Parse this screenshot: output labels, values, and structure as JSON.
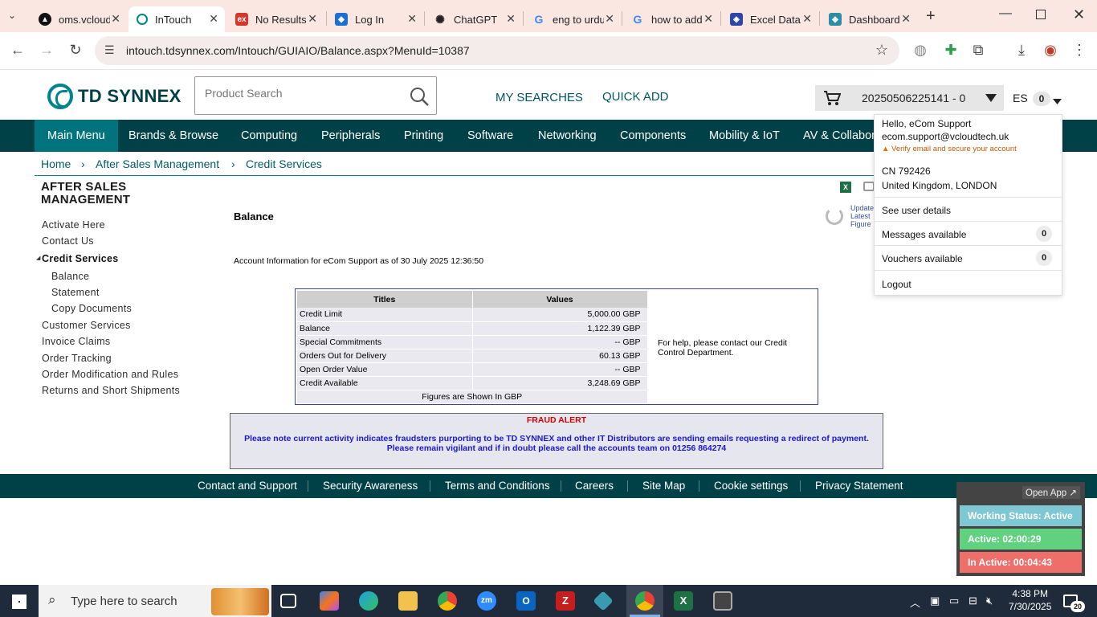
{
  "browser": {
    "tabs": [
      {
        "title": "oms.vcloudtech",
        "active": false
      },
      {
        "title": "InTouch",
        "active": true
      },
      {
        "title": "No Results",
        "active": false
      },
      {
        "title": "Log In",
        "active": false
      },
      {
        "title": "ChatGPT",
        "active": false
      },
      {
        "title": "eng to urdu",
        "active": false
      },
      {
        "title": "how to add",
        "active": false
      },
      {
        "title": "Excel Data",
        "active": false
      },
      {
        "title": "Dashboard",
        "active": false
      }
    ],
    "url": "intouch.tdsynnex.com/Intouch/GUIAIO/Balance.aspx?MenuId=10387"
  },
  "header": {
    "logo": "TD SYNNEX",
    "search_placeholder": "Product Search",
    "my_searches": "MY SEARCHES",
    "quick_add": "QUICK ADD",
    "cart_number": "20250506225141 - 0",
    "lang": "ES",
    "lang_count": "0"
  },
  "menu": [
    "Main Menu",
    "Brands & Browse",
    "Computing",
    "Peripherals",
    "Printing",
    "Software",
    "Networking",
    "Components",
    "Mobility & IoT",
    "AV & Collabor"
  ],
  "breadcrumb": [
    "Home",
    "After Sales Management",
    "Credit Services"
  ],
  "sidebar": {
    "heading": "AFTER SALES MANAGEMENT",
    "items": [
      "Activate Here",
      "Contact Us",
      "Credit Services",
      "Balance",
      "Statement",
      "Copy Documents",
      "Customer Services",
      "Invoice Claims",
      "Order Tracking",
      "Order Modification and Rules",
      "Returns and Short Shipments"
    ]
  },
  "content": {
    "heading": "Balance",
    "account_info": "Account Information for eCom Support as of 30 July 2025 12:36:50",
    "update_text": [
      "Update",
      "Latest",
      "Figure"
    ],
    "table": {
      "headers": [
        "Titles",
        "Values"
      ],
      "rows": [
        [
          "Credit Limit",
          "5,000.00 GBP"
        ],
        [
          "Balance",
          "1,122.39 GBP"
        ],
        [
          "Special Commitments",
          "-- GBP"
        ],
        [
          "Orders Out for Delivery",
          "60.13 GBP"
        ],
        [
          "Open Order Value",
          "-- GBP"
        ],
        [
          "Credit Available",
          "3,248.69 GBP"
        ]
      ],
      "footer": "Figures are Shown In GBP"
    },
    "help": "For help, please contact our Credit Control Department.",
    "fraud_title": "FRAUD ALERT",
    "fraud_body": "Please note current activity indicates fraudsters purporting to be TD SYNNEX and other IT Distributors are sending emails requesting a redirect of payment. Please remain vigilant and if in doubt please call the accounts team on 01256 864274"
  },
  "footer": [
    "Contact and Support",
    "Security Awareness",
    "Terms and Conditions",
    "Careers",
    "Site Map",
    "Cookie settings",
    "Privacy Statement"
  ],
  "user_menu": {
    "hello": "Hello, eCom Support",
    "email": "ecom.support@vcloudtech.uk",
    "verify": "Verify email and secure your account",
    "cn": "CN 792426",
    "location": "United Kingdom, LONDON",
    "see_details": "See user details",
    "messages": "Messages available",
    "messages_count": "0",
    "vouchers": "Vouchers available",
    "vouchers_count": "0",
    "logout": "Logout"
  },
  "widget": {
    "open_app": "Open App ↗",
    "status": "Working Status: Active",
    "active": "Active: 02:00:29",
    "inactive": "In Active: 00:04:43",
    "colors": {
      "status": "#7ec8d4",
      "active": "#5fd17f",
      "inactive": "#ee6f6a"
    }
  },
  "taskbar": {
    "search": "Type here to search",
    "time": "4:38 PM",
    "date": "7/30/2025",
    "notif": "20"
  },
  "colors": {
    "brand_dark": "#004047",
    "brand_teal": "#01838f",
    "tab_bg": "#fae7e2"
  }
}
